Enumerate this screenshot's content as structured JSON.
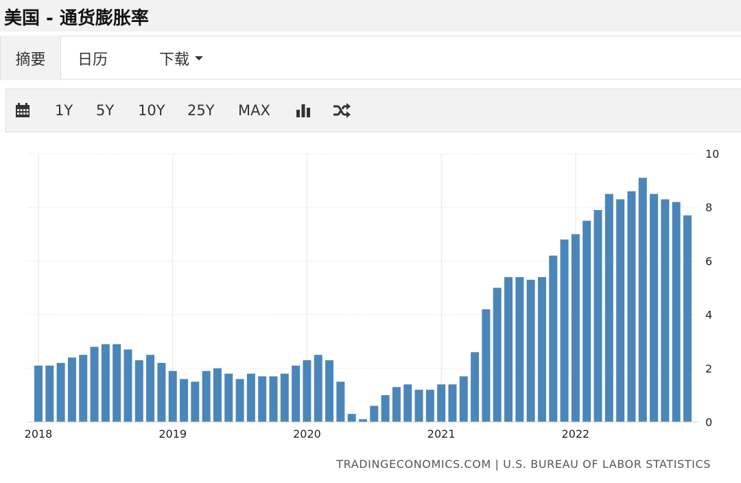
{
  "header": {
    "title": "美国 - 通货膨胀率"
  },
  "tabs": [
    {
      "label": "摘要",
      "active": true
    },
    {
      "label": "日历",
      "active": false
    },
    {
      "label": "下载",
      "active": false
    }
  ],
  "toolbar": {
    "calendar_icon": "calendar-icon",
    "ranges": [
      "1Y",
      "5Y",
      "10Y",
      "25Y",
      "MAX"
    ],
    "bar_chart_icon": "bar-chart-icon",
    "shuffle_icon": "shuffle-icon"
  },
  "chart_data": {
    "type": "bar",
    "title": "",
    "xlabel": "",
    "ylabel": "",
    "ylim": [
      0,
      10
    ],
    "yticks": [
      "0",
      "2",
      "4",
      "6",
      "8",
      "10"
    ],
    "xticks": [
      "2018",
      "2019",
      "2020",
      "2021",
      "2022"
    ],
    "grid": true,
    "y_axis_side": "right",
    "bar_color": "#4a86b9",
    "categories": [
      "2018-01",
      "2018-02",
      "2018-03",
      "2018-04",
      "2018-05",
      "2018-06",
      "2018-07",
      "2018-08",
      "2018-09",
      "2018-10",
      "2018-11",
      "2018-12",
      "2019-01",
      "2019-02",
      "2019-03",
      "2019-04",
      "2019-05",
      "2019-06",
      "2019-07",
      "2019-08",
      "2019-09",
      "2019-10",
      "2019-11",
      "2019-12",
      "2020-01",
      "2020-02",
      "2020-03",
      "2020-04",
      "2020-05",
      "2020-06",
      "2020-07",
      "2020-08",
      "2020-09",
      "2020-10",
      "2020-11",
      "2020-12",
      "2021-01",
      "2021-02",
      "2021-03",
      "2021-04",
      "2021-05",
      "2021-06",
      "2021-07",
      "2021-08",
      "2021-09",
      "2021-10",
      "2021-11",
      "2021-12",
      "2022-01",
      "2022-02",
      "2022-03",
      "2022-04",
      "2022-05",
      "2022-06",
      "2022-07",
      "2022-08",
      "2022-09",
      "2022-10"
    ],
    "values": [
      2.1,
      2.1,
      2.2,
      2.4,
      2.5,
      2.8,
      2.9,
      2.9,
      2.7,
      2.3,
      2.5,
      2.2,
      1.9,
      1.6,
      1.5,
      1.9,
      2.0,
      1.8,
      1.6,
      1.8,
      1.7,
      1.7,
      1.8,
      2.1,
      2.3,
      2.5,
      2.3,
      1.5,
      0.3,
      0.1,
      0.6,
      1.0,
      1.3,
      1.4,
      1.2,
      1.2,
      1.4,
      1.4,
      1.7,
      2.6,
      4.2,
      5.0,
      5.4,
      5.4,
      5.3,
      5.4,
      6.2,
      6.8,
      7.0,
      7.5,
      7.9,
      8.5,
      8.3,
      8.6,
      9.1,
      8.5,
      8.3,
      8.2,
      7.7
    ]
  },
  "source": "TRADINGECONOMICS.COM  |  U.S. BUREAU OF LABOR STATISTICS"
}
